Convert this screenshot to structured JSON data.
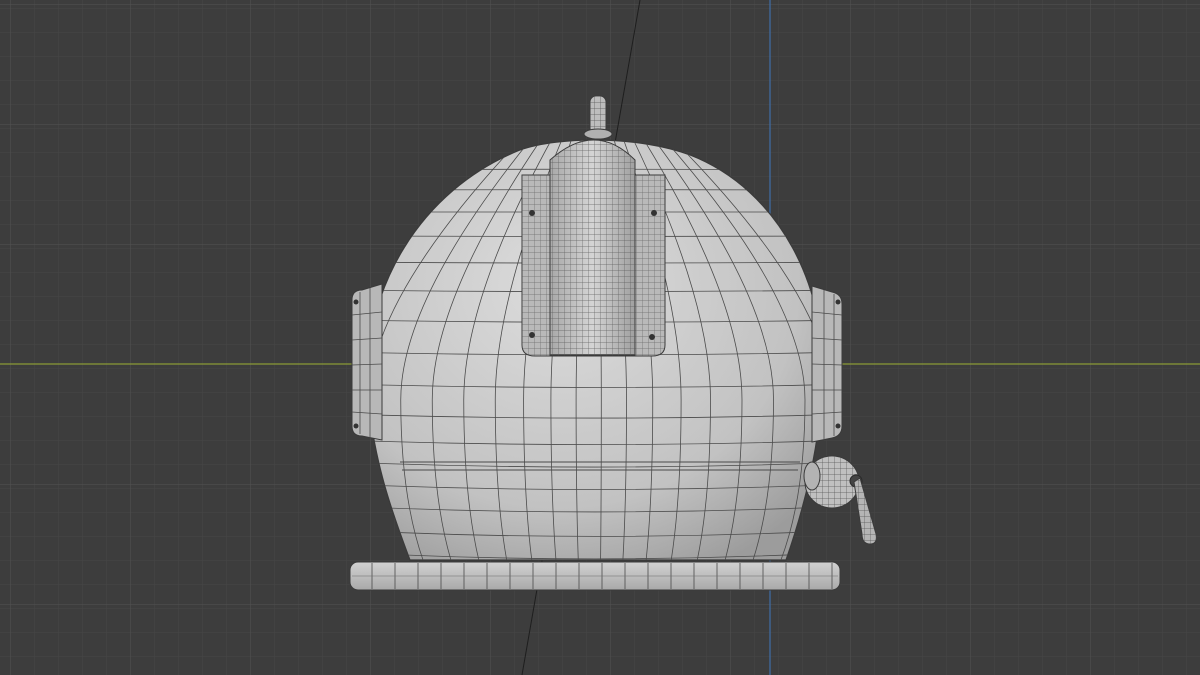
{
  "viewport": {
    "background": "#3d3d3d",
    "grid_minor_color": "#474747",
    "grid_major_color": "#525252",
    "axis_x_color": "#8a9a35",
    "axis_z_color": "#3f6ea8",
    "diagonal_axis_color": "#1e1e1e",
    "mesh_fill": "#c9c9c9",
    "mesh_shade": "#9a9a9a",
    "wire_color": "#3a3a3a"
  },
  "object": {
    "name_icon": "diving-helmet-mesh",
    "parts": [
      "dome",
      "top-knob",
      "top-ridge",
      "left-porthole",
      "right-porthole",
      "side-valve",
      "valve-handle",
      "base-ring"
    ]
  }
}
